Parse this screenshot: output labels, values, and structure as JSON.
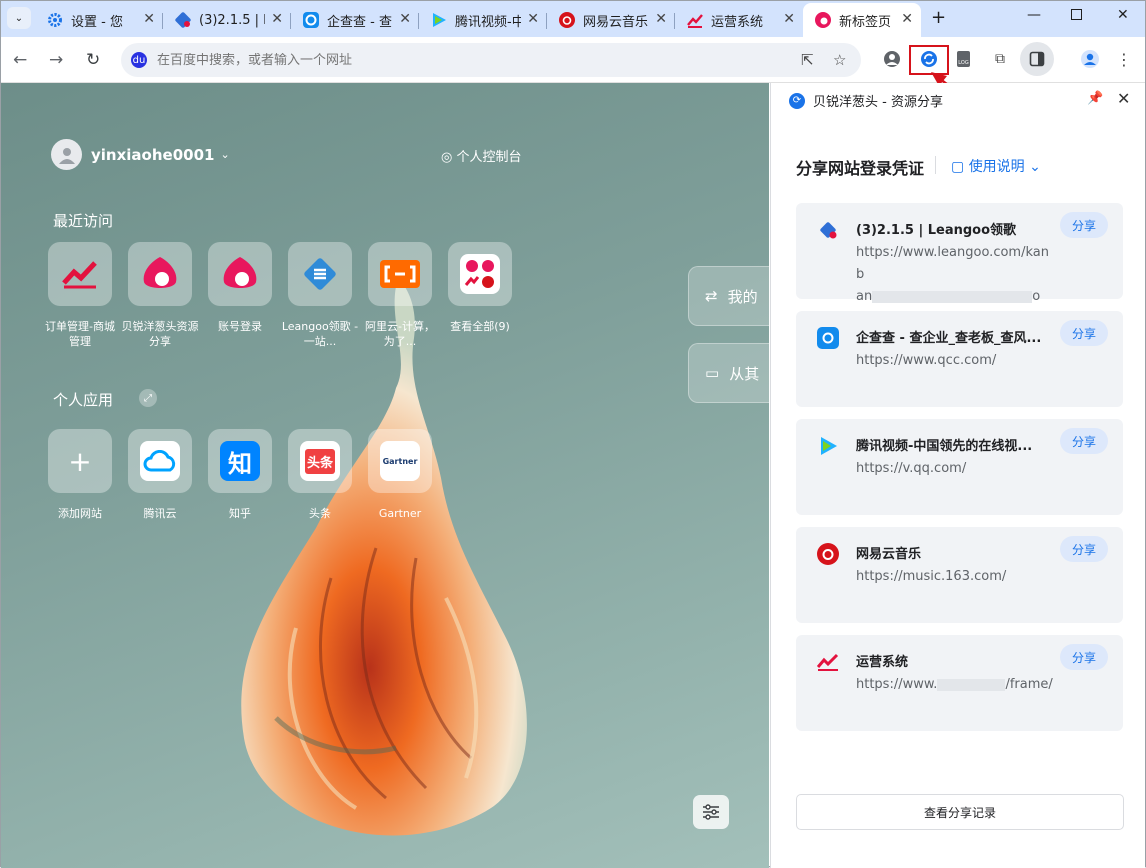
{
  "tabs": [
    {
      "title": "设置 - 您",
      "icon": "gear-icon",
      "color": "#1a73e8"
    },
    {
      "title": "(3)2.1.5 | L",
      "icon": "leangoo-icon",
      "color": "#2f6fd6"
    },
    {
      "title": "企查查 - 查",
      "icon": "qcc-icon",
      "color": "#128bed"
    },
    {
      "title": "腾讯视频-中",
      "icon": "tencent-video-icon",
      "color": "#20b2ff"
    },
    {
      "title": "网易云音乐",
      "icon": "netease-music-icon",
      "color": "#d6131b"
    },
    {
      "title": "运营系统",
      "icon": "chart-icon",
      "color": "#e3123e"
    },
    {
      "title": "新标签页",
      "icon": "new-tab-icon",
      "color": "#e8175d"
    }
  ],
  "omnibox": {
    "placeholder": "在百度中搜索，或者输入一个网址",
    "engine_badge": "du"
  },
  "user": {
    "name": "yinxiaohe0001"
  },
  "console_label": "个人控制台",
  "recent": {
    "heading": "最近访问",
    "items": [
      {
        "label": "订单管理-商城管理",
        "icon": "chart-icon",
        "bg": "#ffffff",
        "fg": "#e3123e"
      },
      {
        "label": "贝锐洋葱头资源分享",
        "icon": "onion-icon",
        "bg": "#ffffff",
        "fg": "#e8175d"
      },
      {
        "label": "账号登录",
        "icon": "onion-icon",
        "bg": "#ffffff",
        "fg": "#e8175d"
      },
      {
        "label": "Leangoo领歌 - 一站...",
        "icon": "leangoo-icon",
        "bg": "#2f8bd8",
        "fg": "#ffffff"
      },
      {
        "label": "阿里云-计算，为了...",
        "icon": "aliyun-icon",
        "bg": "#ff6a00",
        "fg": "#ffffff"
      },
      {
        "label": "查看全部(9)",
        "icon": "grid-icon",
        "bg": "#ffffff",
        "fg": "#e8175d"
      }
    ]
  },
  "apps": {
    "heading": "个人应用",
    "items": [
      {
        "label": "添加网站",
        "icon": "plus-icon",
        "glyph": "+"
      },
      {
        "label": "腾讯云",
        "icon": "tencent-cloud-icon",
        "glyph": ""
      },
      {
        "label": "知乎",
        "icon": "zhihu-icon",
        "glyph": "知"
      },
      {
        "label": "头条",
        "icon": "toutiao-icon",
        "glyph": "头条"
      },
      {
        "label": "Gartner",
        "icon": "gartner-icon",
        "glyph": "Gartner"
      }
    ]
  },
  "side_cards": [
    {
      "label": "我的"
    },
    {
      "label": "从其"
    }
  ],
  "panel": {
    "header": "贝锐洋葱头 - 资源分享",
    "title": "分享网站登录凭证",
    "usage": "使用说明",
    "share_label": "分享",
    "view_records": "查看分享记录",
    "items": [
      {
        "name": "(3)2.1.5 | Leangoo领歌",
        "url1": "https://www.leangoo.com/kanb",
        "url2a": "an",
        "url2b": "o-...",
        "icon": "leangoo-icon",
        "color": "#2f6fd6"
      },
      {
        "name": "企查查 - 查企业_查老板_查风...",
        "url1": "https://www.qcc.com/",
        "icon": "qcc-icon",
        "color": "#128bed"
      },
      {
        "name": "腾讯视频-中国领先的在线视...",
        "url1": "https://v.qq.com/",
        "icon": "tencent-video-icon",
        "color": "#20b2ff"
      },
      {
        "name": "网易云音乐",
        "url1": "https://music.163.com/",
        "icon": "netease-music-icon",
        "color": "#d6131b"
      },
      {
        "name": "运营系统",
        "url1a": "https://www.",
        "url1b": "/frame/",
        "icon": "chart-icon",
        "color": "#e3123e"
      }
    ]
  }
}
